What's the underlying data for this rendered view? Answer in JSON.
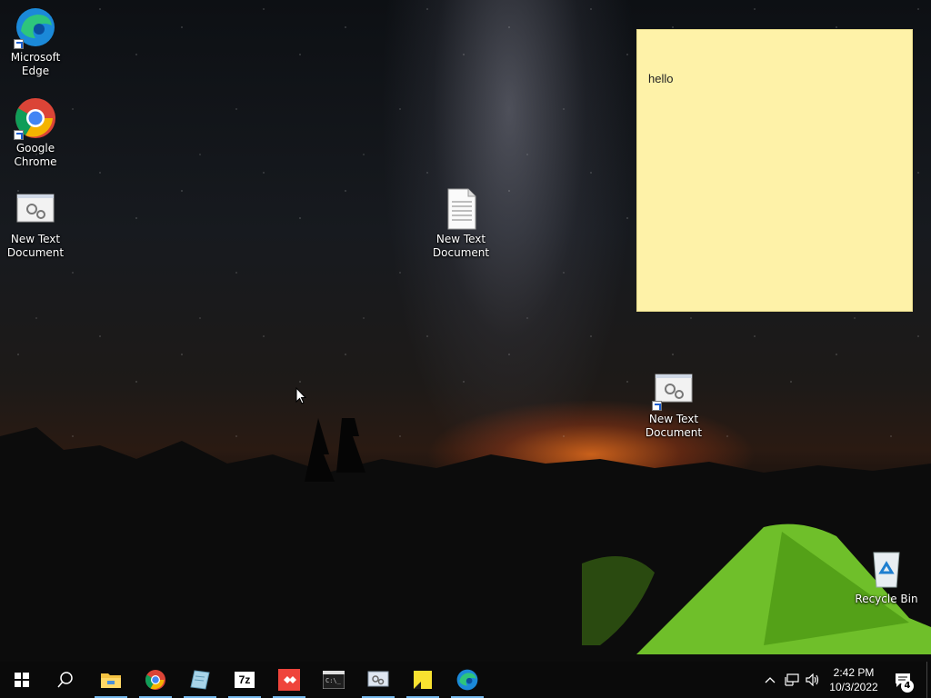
{
  "desktop": {
    "icons": [
      {
        "label": "Microsoft Edge",
        "icon": "edge-icon"
      },
      {
        "label": "Google Chrome",
        "icon": "chrome-icon"
      },
      {
        "label": "New Text Document",
        "icon": "settings-window-icon"
      },
      {
        "label": "New Text Document",
        "icon": "text-file-icon"
      },
      {
        "label": "New Text Document",
        "icon": "settings-window-icon"
      },
      {
        "label": "Recycle Bin",
        "icon": "recycle-bin-icon"
      }
    ],
    "sticky_note": {
      "text": "hello",
      "color": "#fef2a8"
    }
  },
  "taskbar": {
    "background": "#0a0a0a",
    "accent": "#76b9ed",
    "buttons": [
      {
        "icon": "windows-start-icon"
      },
      {
        "icon": "search-icon"
      },
      {
        "icon": "file-explorer-icon"
      },
      {
        "icon": "chrome-icon"
      },
      {
        "icon": "notepad-icon"
      },
      {
        "icon": "7zip-icon",
        "text": "7z"
      },
      {
        "icon": "anydesk-icon"
      },
      {
        "icon": "command-prompt-icon"
      },
      {
        "icon": "control-panel-icon"
      },
      {
        "icon": "sticky-notes-icon"
      },
      {
        "icon": "edge-icon"
      }
    ],
    "tray": {
      "icons": [
        "chevron-up-icon",
        "network-icon",
        "volume-icon"
      ],
      "time": "2:42 PM",
      "date": "10/3/2022",
      "notification_count": "4"
    }
  }
}
